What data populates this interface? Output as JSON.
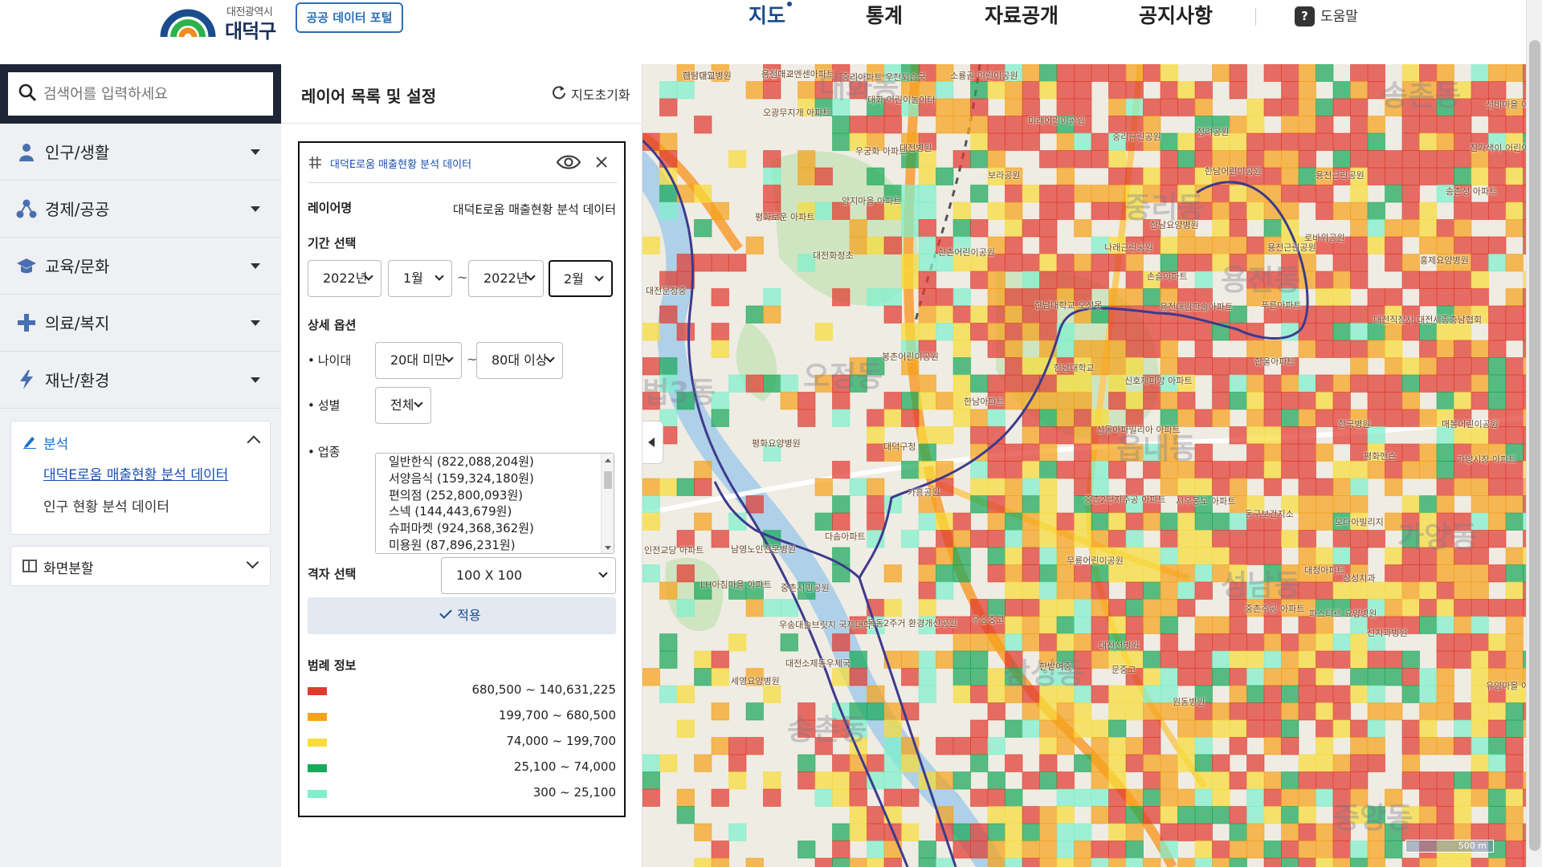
{
  "header": {
    "logo_city": "대전광역시",
    "logo_gu": "대덕구",
    "portal_button": "공공 데이터 포털",
    "nav": [
      {
        "label": "지도",
        "active": true
      },
      {
        "label": "통계",
        "active": false
      },
      {
        "label": "자료공개",
        "active": false
      },
      {
        "label": "공지사항",
        "active": false
      }
    ],
    "help": "도움말",
    "colors": {
      "brand": "#1a4c8e",
      "accent": "#2d6fb5"
    }
  },
  "sidebar": {
    "search_placeholder": "검색어를 입력하세요",
    "categories": [
      {
        "label": "인구/생활",
        "icon": "person-icon"
      },
      {
        "label": "경제/공공",
        "icon": "network-icon"
      },
      {
        "label": "교육/문화",
        "icon": "graduation-cap-icon"
      },
      {
        "label": "의료/복지",
        "icon": "medical-cross-icon"
      },
      {
        "label": "재난/환경",
        "icon": "lightning-icon"
      }
    ],
    "analysis": {
      "title": "분석",
      "items": [
        "대덕E로움 매출현황 분석 데이터",
        "인구 현황 분석 데이터"
      ]
    },
    "split_screen": "화면분할"
  },
  "panel": {
    "title": "레이어 목록 및 설정",
    "reset": "지도초기화",
    "card": {
      "title": "대덕E로움 매출현황 분석 데이터",
      "layer_name_label": "레이어명",
      "layer_name_value": "대덕E로움 매출현황 분석 데이터",
      "period_label": "기간 선택",
      "period": {
        "start_year": "2022년",
        "start_month": "1월",
        "end_year": "2022년",
        "end_month": "2월",
        "separator": "~"
      },
      "detail_label": "상세 옵션",
      "age_label": "나이대",
      "age_from": "20대 미만",
      "age_to": "80대 이상",
      "gender_label": "성별",
      "gender_value": "전체",
      "industry_label": "업종",
      "industries": [
        "일반한식 (822,088,204원)",
        "서양음식 (159,324,180원)",
        "편의점 (252,800,093원)",
        "스넥 (144,443,679원)",
        "슈퍼마켓 (924,368,362원)",
        "미용원 (87,896,231원)"
      ],
      "grid_label": "격자 선택",
      "grid_value": "100 X 100",
      "apply": "적용",
      "legend_label": "범례 정보",
      "legend": [
        {
          "color": "#e03a2f",
          "range": "680,500 ~ 140,631,225"
        },
        {
          "color": "#f5a21b",
          "range": "199,700 ~ 680,500"
        },
        {
          "color": "#f7dc3a",
          "range": "74,000 ~ 199,700"
        },
        {
          "color": "#1aa85a",
          "range": "25,100 ~ 74,000"
        },
        {
          "color": "#7ef0cc",
          "range": "300 ~ 25,100"
        }
      ]
    }
  },
  "map": {
    "scale": "500 m",
    "districts": [
      "대화동",
      "송촌동",
      "중리동",
      "오정동",
      "법3동",
      "읍내동",
      "송촌동",
      "삼성동",
      "성남동",
      "중앙동",
      "가양동",
      "용전동"
    ],
    "places": [
      "대전한일병원",
      "금성백조엔센아파트",
      "중리아파트 우천퇴습국",
      "소룡골 어린이공원",
      "선비마을 아파트",
      "오광무지개 아파트",
      "대화 어린이놀이터",
      "미래어린이공원",
      "중리근린공원",
      "정려공원",
      "진가색이 어린이공원",
      "우궁화 아파트",
      "대전병원",
      "보라공원",
      "한남어린이공원",
      "용전근린공원",
      "송촌성 아파트",
      "평화로운 아파트",
      "양지마을 아파트",
      "한남요양병원",
      "나래근린공원",
      "용전근린공원",
      "로바위공원",
      "홍제요양병원",
      "대전화정초",
      "한촌어린이공원",
      "손슬아파트",
      "대전문정중",
      "한남대학교 오정못",
      "용전대림한솔아파트",
      "푸른아파트",
      "대전직장사 대전세종충남협회",
      "봉촌어린이공원",
      "한남대학교",
      "한울아파트",
      "신호제피앙 아파트",
      "한남아파트",
      "신동아파밀리아 아파트",
      "한국병원",
      "매봉어린이공원",
      "평화요양병원",
      "대덕구청",
      "평화맨슨",
      "가양시장 아파트",
      "가흥공원",
      "중촌2단지주공 아파트",
      "서우옹도 아파트",
      "동구보건지소",
      "오다아빌리지",
      "인전교당 아파트",
      "다솜아파트",
      "무룡어린이공원",
      "대청아파트",
      "상성치과",
      "LH아침마을 아파트",
      "중촌시민공원",
      "중촌주공 아파트",
      "파스티르 요양병원",
      "우송대솔브릿지 국제대학",
      "목동2주거 환경개선공원",
      "선치과병원",
      "대전소제동우체국",
      "대전선병원",
      "문중고",
      "한밭여중",
      "세영요양병원",
      "원동병원",
      "유양마을 아파트",
      "남영노인전문병원",
      "우송중고",
      "한남대교",
      "용전대교"
    ]
  }
}
